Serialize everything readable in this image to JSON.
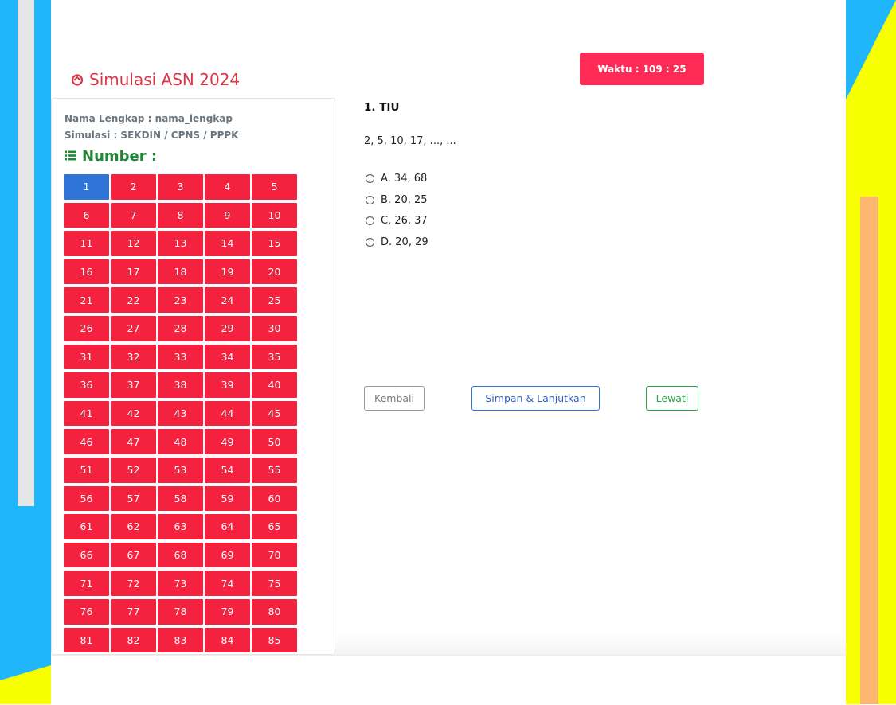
{
  "brand": {
    "title": "Simulasi ASN 2024",
    "icon": "home-icon"
  },
  "timer": {
    "label": "Waktu : 109 : 25"
  },
  "sidebar": {
    "name_line": "Nama Lengkap : nama_lengkap",
    "simulation_line": "Simulasi : SEKDIN / CPNS / PPPK",
    "number_title": "Number :",
    "active_number": "1",
    "numbers": [
      "1",
      "2",
      "3",
      "4",
      "5",
      "6",
      "7",
      "8",
      "9",
      "10",
      "11",
      "12",
      "13",
      "14",
      "15",
      "16",
      "17",
      "18",
      "19",
      "20",
      "21",
      "22",
      "23",
      "24",
      "25",
      "26",
      "27",
      "28",
      "29",
      "30",
      "31",
      "32",
      "33",
      "34",
      "35",
      "36",
      "37",
      "38",
      "39",
      "40",
      "41",
      "42",
      "43",
      "44",
      "45",
      "46",
      "47",
      "48",
      "49",
      "50",
      "51",
      "52",
      "53",
      "54",
      "55",
      "56",
      "57",
      "58",
      "59",
      "60",
      "61",
      "62",
      "63",
      "64",
      "65",
      "66",
      "67",
      "68",
      "69",
      "70",
      "71",
      "72",
      "73",
      "74",
      "75",
      "76",
      "77",
      "78",
      "79",
      "80",
      "81",
      "82",
      "83",
      "84",
      "85"
    ]
  },
  "question": {
    "title": "1. TIU",
    "text": "2, 5, 10, 17, ..., ...",
    "options": [
      {
        "label": "A. 34, 68"
      },
      {
        "label": "B. 20, 25"
      },
      {
        "label": "C. 26, 37"
      },
      {
        "label": "D. 20, 29"
      }
    ]
  },
  "buttons": {
    "back": "Kembali",
    "save_next": "Simpan & Lanjutkan",
    "skip": "Lewati"
  },
  "colors": {
    "brand_red": "#dc3545",
    "timer_bg": "#ff2a55",
    "number_bg": "#f5223f",
    "number_active_bg": "#2f74d8",
    "number_title_green": "#218838",
    "backdrop_blue": "#1fb6fb",
    "backdrop_yellow": "#f8ff00"
  }
}
